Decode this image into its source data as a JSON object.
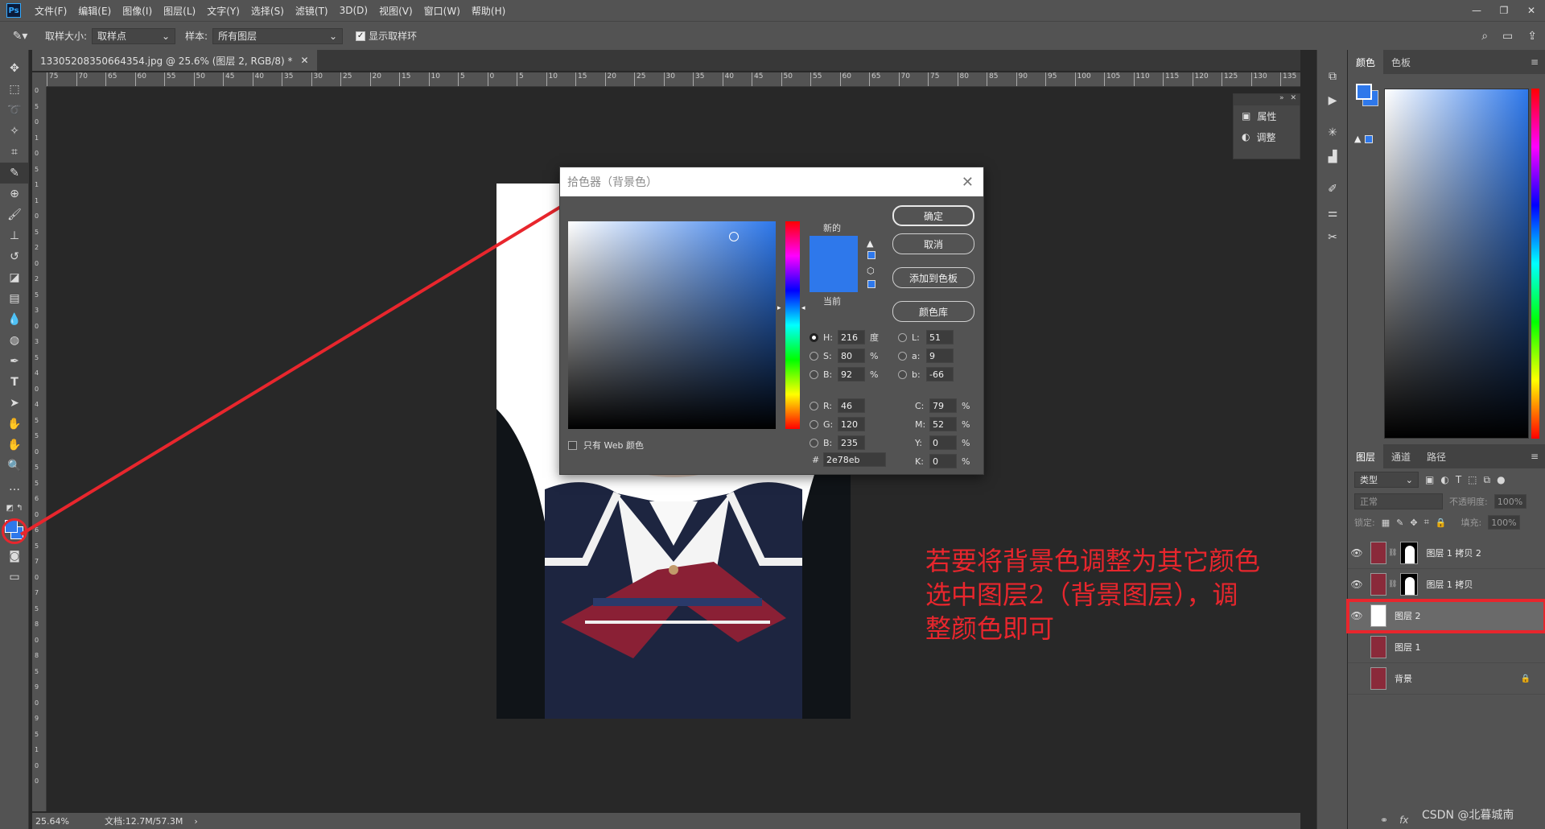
{
  "app": {
    "logo": "Ps",
    "menu": [
      "文件(F)",
      "编辑(E)",
      "图像(I)",
      "图层(L)",
      "文字(Y)",
      "选择(S)",
      "滤镜(T)",
      "3D(D)",
      "视图(V)",
      "窗口(W)",
      "帮助(H)"
    ]
  },
  "options": {
    "sample_size_label": "取样大小:",
    "sample_size_value": "取样点",
    "sample_label": "样本:",
    "sample_value": "所有图层",
    "show_ring_label": "显示取样环"
  },
  "document": {
    "tab_title": "13305208350664354.jpg @ 25.6% (图层 2, RGB/8) *",
    "ruler_h": [
      "75",
      "70",
      "65",
      "60",
      "55",
      "50",
      "45",
      "40",
      "35",
      "30",
      "25",
      "20",
      "15",
      "10",
      "5",
      "0",
      "5",
      "10",
      "15",
      "20",
      "25",
      "30",
      "35",
      "40",
      "45",
      "50",
      "55",
      "60",
      "65",
      "70",
      "75",
      "80",
      "85",
      "90",
      "95",
      "100",
      "105",
      "110",
      "115",
      "120",
      "125",
      "130",
      "135"
    ],
    "ruler_v": [
      "0",
      "5",
      "0",
      "1",
      "0",
      "5",
      "1",
      "1",
      "0",
      "5",
      "2",
      "0",
      "2",
      "5",
      "3",
      "0",
      "3",
      "5",
      "4",
      "0",
      "4",
      "5",
      "5",
      "0",
      "5",
      "5",
      "6",
      "0",
      "6",
      "5",
      "7",
      "0",
      "7",
      "5",
      "8",
      "0",
      "8",
      "5",
      "9",
      "0",
      "9",
      "5",
      "1",
      "0",
      "0"
    ]
  },
  "status": {
    "zoom": "25.64%",
    "doc_size": "文档:12.7M/57.3M"
  },
  "properties_mini": {
    "properties_label": "属性",
    "adjustments_label": "调整"
  },
  "color_panel": {
    "tabs": [
      "颜色",
      "色板"
    ]
  },
  "layers_panel": {
    "tabs": [
      "图层",
      "通道",
      "路径"
    ],
    "filter_label": "类型",
    "blend_mode": "正常",
    "opacity_label": "不透明度:",
    "opacity_value": "100%",
    "lock_label": "锁定:",
    "fill_label": "填充:",
    "fill_value": "100%",
    "layers": [
      {
        "name": "图层 1 拷贝 2",
        "visible": true,
        "has_mask": true,
        "selected": false
      },
      {
        "name": "图层 1 拷贝",
        "visible": true,
        "has_mask": true,
        "selected": false
      },
      {
        "name": "图层 2",
        "visible": true,
        "has_mask": false,
        "selected": true
      },
      {
        "name": "图层 1",
        "visible": false,
        "has_mask": false,
        "selected": false
      },
      {
        "name": "背景",
        "visible": false,
        "has_mask": false,
        "selected": false,
        "locked": true
      }
    ],
    "footer_fx": "fx"
  },
  "picker_dialog": {
    "title": "拾色器（背景色）",
    "ok_label": "确定",
    "cancel_label": "取消",
    "add_swatch_label": "添加到色板",
    "library_label": "颜色库",
    "new_label": "新的",
    "current_label": "当前",
    "web_only_label": "只有 Web 颜色",
    "new_color": "#2e78eb",
    "current_color": "#2e78eb",
    "fields": {
      "H": "216",
      "S": "80",
      "B": "92",
      "R": "46",
      "G": "120",
      "Bb": "235",
      "L": "51",
      "a": "9",
      "b": "-66",
      "C": "79",
      "M": "52",
      "Y": "0",
      "K": "0",
      "hex": "2e78eb"
    },
    "units": {
      "degree": "度",
      "percent": "%"
    }
  },
  "annotation": {
    "text_lines": [
      "若要将背景色调整为其它颜色",
      "选中图层2（背景图层），调",
      "整颜色即可"
    ],
    "color": "#e8262d"
  },
  "watermark": "CSDN @北暮城南",
  "colors": {
    "foreground": "#2e78eb",
    "background": "#2e78eb",
    "accent_red": "#e8262d"
  }
}
